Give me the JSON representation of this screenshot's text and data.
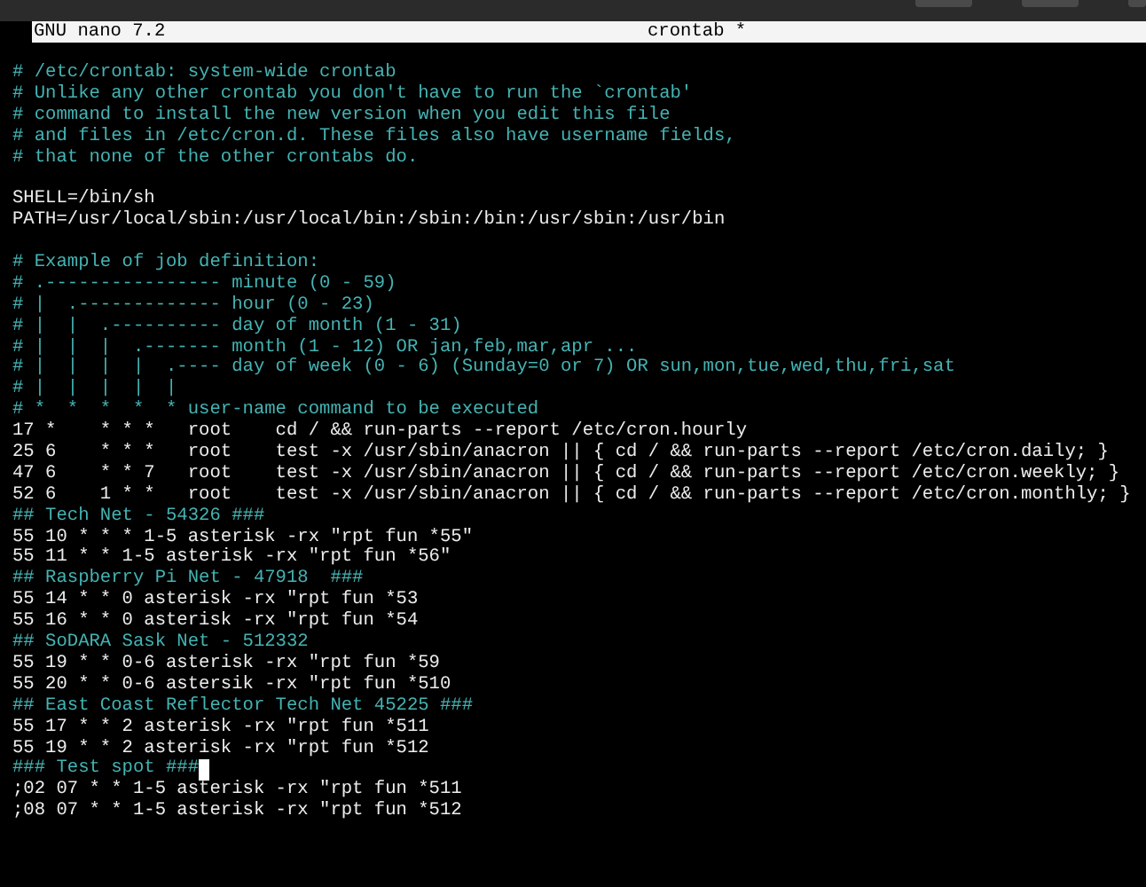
{
  "title_bar": {
    "app": "GNU nano 7.2",
    "filename": "crontab *"
  },
  "lines": [
    {
      "kind": "comment",
      "text": "# /etc/crontab: system-wide crontab",
      "cursor": false
    },
    {
      "kind": "comment",
      "text": "# Unlike any other crontab you don't have to run the `crontab'",
      "cursor": false
    },
    {
      "kind": "comment",
      "text": "# command to install the new version when you edit this file",
      "cursor": false
    },
    {
      "kind": "comment",
      "text": "# and files in /etc/cron.d. These files also have username fields,",
      "cursor": false
    },
    {
      "kind": "comment",
      "text": "# that none of the other crontabs do.",
      "cursor": false
    },
    {
      "kind": "blank",
      "cursor": false
    },
    {
      "kind": "code",
      "text": "SHELL=/bin/sh",
      "cursor": false
    },
    {
      "kind": "code",
      "text": "PATH=/usr/local/sbin:/usr/local/bin:/sbin:/bin:/usr/sbin:/usr/bin",
      "cursor": false
    },
    {
      "kind": "blank",
      "cursor": false
    },
    {
      "kind": "comment",
      "text": "# Example of job definition:",
      "cursor": false
    },
    {
      "kind": "comment",
      "text": "# .---------------- minute (0 - 59)",
      "cursor": false
    },
    {
      "kind": "comment",
      "text": "# |  .------------- hour (0 - 23)",
      "cursor": false
    },
    {
      "kind": "comment",
      "text": "# |  |  .---------- day of month (1 - 31)",
      "cursor": false
    },
    {
      "kind": "comment",
      "text": "# |  |  |  .------- month (1 - 12) OR jan,feb,mar,apr ...",
      "cursor": false
    },
    {
      "kind": "comment",
      "text": "# |  |  |  |  .---- day of week (0 - 6) (Sunday=0 or 7) OR sun,mon,tue,wed,thu,fri,sat",
      "cursor": false
    },
    {
      "kind": "comment",
      "text": "# |  |  |  |  |",
      "cursor": false
    },
    {
      "kind": "comment",
      "text": "# *  *  *  *  * user-name command to be executed",
      "cursor": false
    },
    {
      "kind": "code",
      "text": "17 *    * * *   root    cd / && run-parts --report /etc/cron.hourly",
      "cursor": false
    },
    {
      "kind": "code",
      "text": "25 6    * * *   root    test -x /usr/sbin/anacron || { cd / && run-parts --report /etc/cron.daily; }",
      "cursor": false
    },
    {
      "kind": "code",
      "text": "47 6    * * 7   root    test -x /usr/sbin/anacron || { cd / && run-parts --report /etc/cron.weekly; }",
      "cursor": false
    },
    {
      "kind": "code",
      "text": "52 6    1 * *   root    test -x /usr/sbin/anacron || { cd / && run-parts --report /etc/cron.monthly; }",
      "cursor": false
    },
    {
      "kind": "comment",
      "text": "## Tech Net - 54326 ###",
      "cursor": false
    },
    {
      "kind": "code",
      "text": "55 10 * * * 1-5 asterisk -rx \"rpt fun *55\"",
      "cursor": false
    },
    {
      "kind": "code",
      "text": "55 11 * * 1-5 asterisk -rx \"rpt fun *56\"",
      "cursor": false
    },
    {
      "kind": "comment",
      "text": "## Raspberry Pi Net - 47918  ###",
      "cursor": false
    },
    {
      "kind": "code",
      "text": "55 14 * * 0 asterisk -rx \"rpt fun *53",
      "cursor": false
    },
    {
      "kind": "code",
      "text": "55 16 * * 0 asterisk -rx \"rpt fun *54",
      "cursor": false
    },
    {
      "kind": "comment",
      "text": "## SoDARA Sask Net - 512332",
      "cursor": false
    },
    {
      "kind": "code",
      "text": "55 19 * * 0-6 asterisk -rx \"rpt fun *59",
      "cursor": false
    },
    {
      "kind": "code",
      "text": "55 20 * * 0-6 astersik -rx \"rpt fun *510",
      "cursor": false
    },
    {
      "kind": "comment",
      "text": "## East Coast Reflector Tech Net 45225 ###",
      "cursor": false
    },
    {
      "kind": "code",
      "text": "55 17 * * 2 asterisk -rx \"rpt fun *511",
      "cursor": false
    },
    {
      "kind": "code",
      "text": "55 19 * * 2 asterisk -rx \"rpt fun *512",
      "cursor": false
    },
    {
      "kind": "comment",
      "text": "### Test spot ###",
      "cursor": true
    },
    {
      "kind": "code",
      "text": ";02 07 * * 1-5 asterisk -rx \"rpt fun *511",
      "cursor": false
    },
    {
      "kind": "code",
      "text": ";08 07 * * 1-5 asterisk -rx \"rpt fun *512",
      "cursor": false
    }
  ]
}
